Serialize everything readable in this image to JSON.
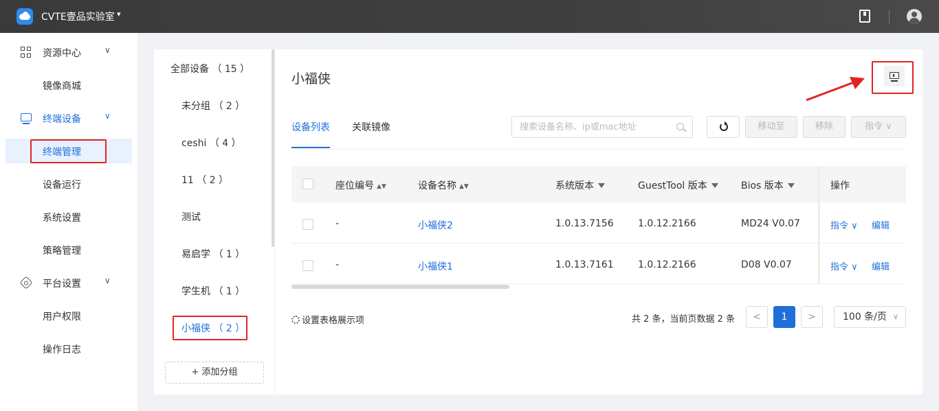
{
  "topbar": {
    "app_title": "CVTE壹品实验室",
    "caret": "▾"
  },
  "sidebar": {
    "groups": [
      {
        "label": "资源中心",
        "items": [
          {
            "label": "镜像商城"
          }
        ]
      },
      {
        "label": "终端设备",
        "items": [
          {
            "label": "终端管理"
          },
          {
            "label": "设备运行"
          },
          {
            "label": "系统设置"
          },
          {
            "label": "策略管理"
          }
        ]
      },
      {
        "label": "平台设置",
        "items": [
          {
            "label": "用户权限"
          },
          {
            "label": "操作日志"
          }
        ]
      }
    ],
    "chevron": "∨"
  },
  "groups_panel": {
    "items": [
      {
        "label": "全部设备 （ 15 ）"
      },
      {
        "label": "未分组 （ 2 ）"
      },
      {
        "label": "ceshi （ 4 ）"
      },
      {
        "label": "11 （ 2 ）"
      },
      {
        "label": "测试"
      },
      {
        "label": "易启学 （ 1 ）"
      },
      {
        "label": "学生机 （ 1 ）"
      },
      {
        "label": "小福侠 （ 2 ）"
      }
    ],
    "add_group": "+  添加分组"
  },
  "main": {
    "title": "小福侠",
    "tabs": [
      {
        "label": "设备列表"
      },
      {
        "label": "关联镜像"
      }
    ],
    "search_placeholder": "搜索设备名称、ip或mac地址",
    "buttons": {
      "move_to": "移动至",
      "remove": "移除",
      "command": "指令 ∨"
    },
    "table": {
      "columns": [
        "座位编号",
        "设备名称",
        "系统版本",
        "GuestTool 版本",
        "Bios 版本",
        "操作"
      ],
      "rows": [
        {
          "seat": "-",
          "name": "小福侠2",
          "os": "1.0.13.7156",
          "guesttool": "1.0.12.2166",
          "bios": "MD24 V0.07",
          "cmd": "指令 ∨",
          "edit": "编辑"
        },
        {
          "seat": "-",
          "name": "小福侠1",
          "os": "1.0.13.7161",
          "guesttool": "1.0.12.2166",
          "bios": "D08 V0.07",
          "cmd": "指令 ∨",
          "edit": "编辑"
        }
      ]
    },
    "footer": {
      "settings": "设置表格展示项",
      "summary": "共 2 条，当前页数据 2 条",
      "prev": "<",
      "page": "1",
      "next": ">",
      "page_size": "100 条/页"
    }
  },
  "colors": {
    "accent": "#1e6fd9",
    "highlight": "#e02424"
  }
}
